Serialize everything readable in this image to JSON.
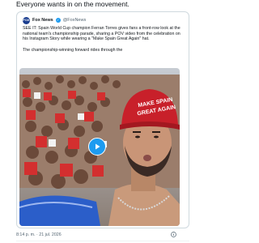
{
  "headline": "Everyone wants in on the movement.",
  "tweet": {
    "avatar_text": "FOX",
    "author_name": "Fox News",
    "handle": "@FoxNews",
    "text": "SEE IT: Spain World Cup champion Ferran Torres gives fans a front-row look at the national team's championship parade, sharing a POV video from the celebration on his Instagram Story while wearing a \"Make Spain Great Again\" hat.",
    "text2": "The championship-winning forward rides through the",
    "hat_text_line1": "MAKE SPAIN",
    "hat_text_line2": "GREAT AGAIN"
  },
  "footer": {
    "timestamp": "8:14 p. m. · 21 jul. 2026"
  },
  "colors": {
    "accent": "#1d9bf0",
    "hat_red": "#c8202a",
    "verified": "#1d9bf0"
  },
  "icons": [
    "verified-icon",
    "play-icon",
    "info-icon"
  ]
}
